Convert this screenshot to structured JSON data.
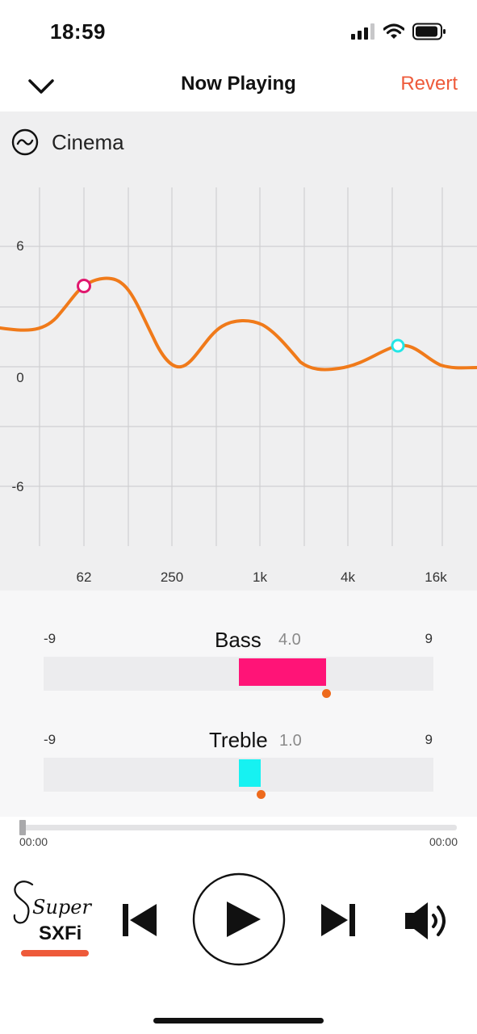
{
  "status": {
    "time": "18:59"
  },
  "nav": {
    "title": "Now Playing",
    "revert_label": "Revert"
  },
  "eq": {
    "preset_name": "Cinema",
    "y_labels": [
      "6",
      "0",
      "-6"
    ],
    "x_labels": [
      "62",
      "250",
      "1k",
      "4k",
      "16k"
    ],
    "curve_color": "#f07a1a",
    "bass_handle_color": "#e0186e",
    "treble_handle_color": "#22e6e6"
  },
  "bass": {
    "label": "Bass",
    "value": "4.0",
    "min": "-9",
    "max": "9",
    "level": 4.0,
    "color": "#ff1477"
  },
  "treble": {
    "label": "Treble",
    "value": "1.0",
    "min": "-9",
    "max": "9",
    "level": 1.0,
    "color": "#16f2f2"
  },
  "playback": {
    "elapsed": "00:00",
    "duration": "00:00",
    "progress": 0
  },
  "controls": {
    "sxfi_word": "Super",
    "sxfi_brand": "SXFi"
  },
  "colors": {
    "accent": "#ee5a3a",
    "knob": "#ee6a1c"
  }
}
